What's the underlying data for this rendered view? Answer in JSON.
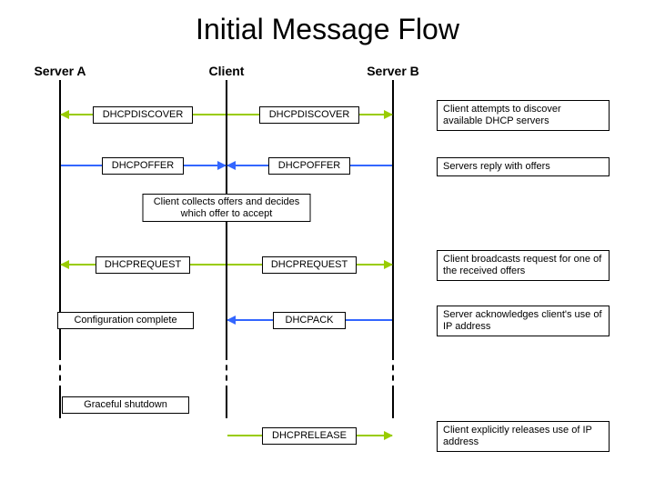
{
  "title": "Initial Message Flow",
  "actors": {
    "a": "Server A",
    "c": "Client",
    "b": "Server B"
  },
  "msg": {
    "discover": "DHCPDISCOVER",
    "offer": "DHCPOFFER",
    "request": "DHCPREQUEST",
    "ack": "DHCPACK",
    "release": "DHCPRELEASE"
  },
  "box": {
    "collect": "Client collects offers and decides which offer to accept",
    "config": "Configuration complete",
    "shutdown": "Graceful shutdown"
  },
  "note": {
    "discover": "Client attempts to discover available DHCP servers",
    "offer": "Servers reply with offers",
    "request": "Client broadcasts request for one of the received offers",
    "ack": "Server acknowledges client's use of IP address",
    "release": "Client explicitly releases use of IP address"
  }
}
